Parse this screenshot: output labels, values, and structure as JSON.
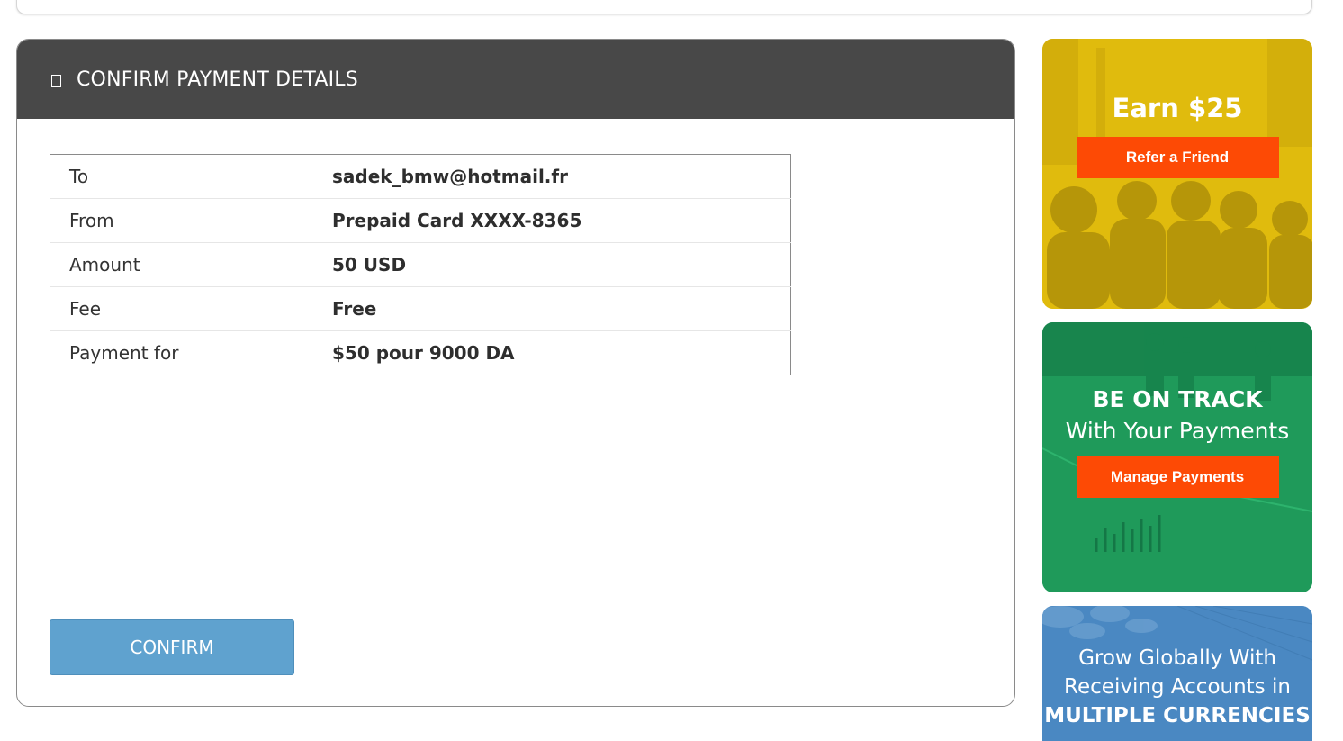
{
  "panel": {
    "title": "CONFIRM PAYMENT DETAILS",
    "icon": "document-icon"
  },
  "details": [
    {
      "label": "To",
      "value": "sadek_bmw@hotmail.fr"
    },
    {
      "label": "From",
      "value": "Prepaid Card XXXX-8365"
    },
    {
      "label": "Amount",
      "value": "50 USD"
    },
    {
      "label": "Fee",
      "value": "Free"
    },
    {
      "label": "Payment for",
      "value": "$50 pour 9000 DA"
    }
  ],
  "confirm_label": "CONFIRM",
  "promos": {
    "referral": {
      "headline": "Earn $25",
      "button": "Refer a Friend",
      "color": "#e0bb0d"
    },
    "payments": {
      "headline": "BE ON TRACK",
      "subline": "With Your Payments",
      "button": "Manage Payments",
      "color": "#1f9a5a"
    },
    "currencies": {
      "line1": "Grow Globally With",
      "line2": "Receiving Accounts in",
      "line3": "MULTIPLE CURRENCIES",
      "color": "#4a88c2"
    }
  },
  "colors": {
    "header_bg": "#484848",
    "confirm_bg": "#5fa2cf",
    "promo_button": "#fd4a05"
  }
}
